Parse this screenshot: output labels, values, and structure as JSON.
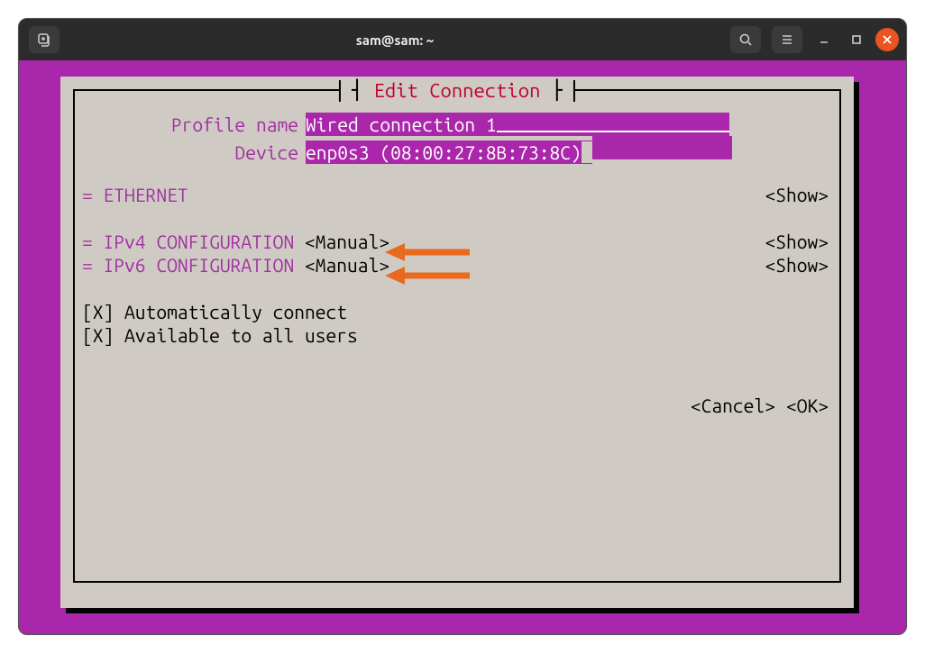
{
  "window": {
    "title": "sam@sam: ~"
  },
  "tui": {
    "title": "Edit Connection",
    "profile_name_label": "Profile name",
    "profile_name_value": "Wired connection 1",
    "device_label": "Device",
    "device_value": "enp0s3 (08:00:27:8B:73:8C)",
    "ethernet_label": "= ETHERNET",
    "ethernet_show": "<Show>",
    "ipv4_label": "= IPv4 CONFIGURATION",
    "ipv4_mode": "<Manual>",
    "ipv4_show": "<Show>",
    "ipv6_label": "= IPv6 CONFIGURATION",
    "ipv6_mode": "<Manual>",
    "ipv6_show": "<Show>",
    "auto_connect": "[X] Automatically connect",
    "all_users": "[X] Available to all users",
    "cancel": "<Cancel>",
    "ok": "<OK>"
  },
  "colors": {
    "accent_purple": "#aa26aa",
    "panel_bg": "#cfcbc4",
    "title_red": "#c00030",
    "arrow_orange": "#e86a1e"
  }
}
